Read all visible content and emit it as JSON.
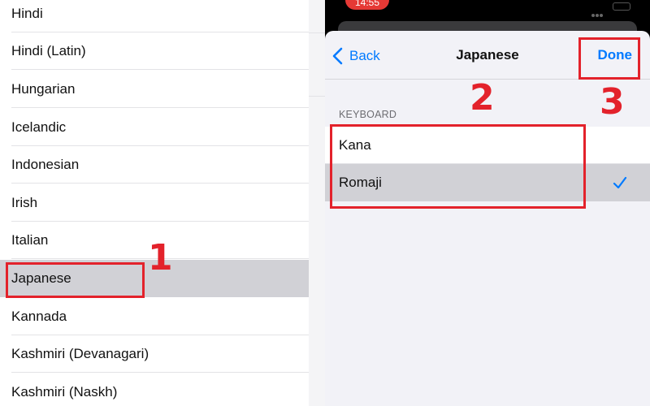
{
  "languages": [
    {
      "label": "Hindi",
      "selected": false
    },
    {
      "label": "Hindi (Latin)",
      "selected": false
    },
    {
      "label": "Hungarian",
      "selected": false
    },
    {
      "label": "Icelandic",
      "selected": false
    },
    {
      "label": "Indonesian",
      "selected": false
    },
    {
      "label": "Irish",
      "selected": false
    },
    {
      "label": "Italian",
      "selected": false
    },
    {
      "label": "Japanese",
      "selected": true
    },
    {
      "label": "Kannada",
      "selected": false
    },
    {
      "label": "Kashmiri (Devanagari)",
      "selected": false
    },
    {
      "label": "Kashmiri (Naskh)",
      "selected": false
    }
  ],
  "status_bar": {
    "time": "14:55"
  },
  "nav": {
    "back_label": "Back",
    "title": "Japanese",
    "done_label": "Done"
  },
  "keyboard_section": {
    "header": "KEYBOARD",
    "options": [
      {
        "label": "Kana",
        "selected": false
      },
      {
        "label": "Romaji",
        "selected": true
      }
    ]
  },
  "annotations": {
    "step1": "1",
    "step2": "2",
    "step3": "3"
  },
  "colors": {
    "accent": "#007aff",
    "annotation": "#e3222b",
    "selected_row": "#d1d1d6"
  },
  "icons": {
    "back": "chevron-left-icon",
    "check": "checkmark-icon"
  }
}
